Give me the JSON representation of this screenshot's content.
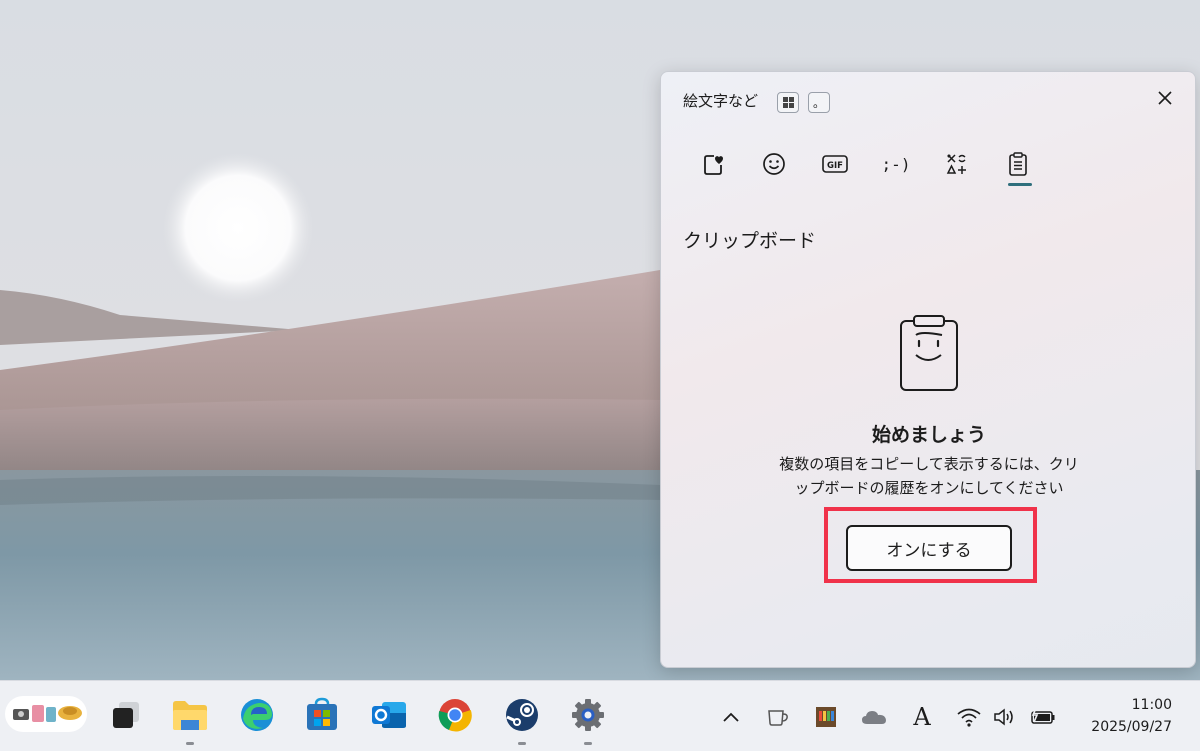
{
  "panel": {
    "title": "絵文字など",
    "key_hint": "。",
    "section_title": "クリップボード",
    "empty_heading": "始めましょう",
    "empty_desc_line1": "複数の項目をコピーして表示するには、クリ",
    "empty_desc_line2": "ップボードの履歴をオンにしてください",
    "turn_on_label": "オンにする",
    "tabs": [
      {
        "name": "favorites",
        "icon": "heart-icon"
      },
      {
        "name": "emoji",
        "icon": "smiley-icon"
      },
      {
        "name": "gif",
        "icon": "gif-icon"
      },
      {
        "name": "kaomoji",
        "label": ";-)"
      },
      {
        "name": "symbols",
        "icon": "symbols-icon"
      },
      {
        "name": "clipboard",
        "icon": "clipboard-icon",
        "selected": true
      }
    ],
    "accent_color": "#2f6f7c",
    "highlight_color": "#f0324a"
  },
  "taskbar": {
    "apps": [
      "widgets",
      "task-view",
      "file-explorer",
      "edge",
      "microsoft-store",
      "outlook",
      "chrome",
      "steam",
      "settings"
    ],
    "tray": [
      "show-hidden-icons",
      "cup",
      "app",
      "onedrive",
      "ime-mode",
      "wifi",
      "volume",
      "battery"
    ],
    "ime_label": "A",
    "time": "11:00",
    "date": "2025/09/27"
  }
}
